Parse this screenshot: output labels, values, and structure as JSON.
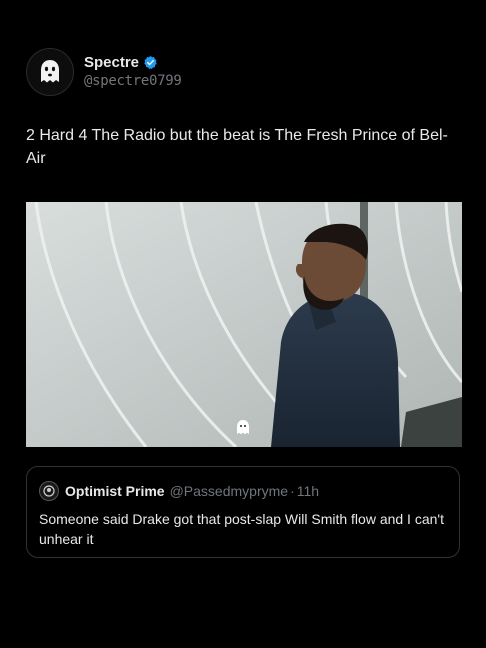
{
  "tweet": {
    "author": {
      "display_name": "Spectre",
      "handle": "@spectre0799",
      "verified": true,
      "avatar_icon": "ghost-icon"
    },
    "text": "2 Hard 4 The Radio but the beat is The Fresh Prince of Bel-Air",
    "media": {
      "type": "video-still",
      "overlay_icon": "ghost-watermark-icon"
    }
  },
  "quote": {
    "author": {
      "display_name": "Optimist Prime",
      "handle": "@Passedmypryme",
      "separator": "·",
      "time": "11h",
      "avatar_icon": "round-avatar-icon"
    },
    "text": "Someone said Drake got that post-slap Will Smith flow and I can't unhear it"
  },
  "colors": {
    "background": "#000000",
    "text": "#e7e9ea",
    "muted": "#71767b",
    "verified_blue": "#1d9bf0",
    "border": "#2f3336"
  }
}
